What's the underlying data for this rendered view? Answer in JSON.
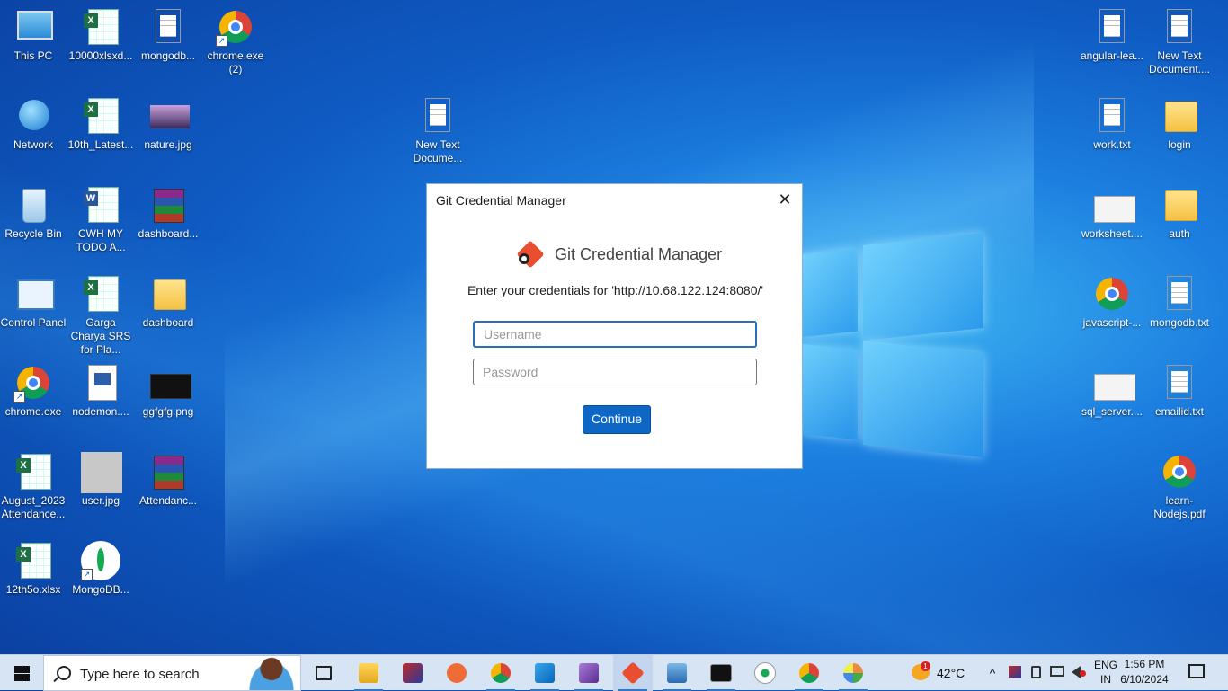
{
  "desktop": {
    "icons_left": [
      {
        "label": "This PC",
        "icon": "this-pc-icon"
      },
      {
        "label": "10000xlsxd...",
        "icon": "excel-file-icon"
      },
      {
        "label": "mongodb...",
        "icon": "text-file-icon"
      },
      {
        "label": "chrome.exe (2)",
        "icon": "chrome-icon"
      },
      {
        "label": "Network",
        "icon": "network-icon"
      },
      {
        "label": "10th_Latest...",
        "icon": "excel-file-icon"
      },
      {
        "label": "nature.jpg",
        "icon": "image-file-icon"
      },
      {
        "label": "Recycle Bin",
        "icon": "recycle-bin-icon"
      },
      {
        "label": "CWH MY TODO A...",
        "icon": "word-file-icon"
      },
      {
        "label": "dashboard...",
        "icon": "rar-archive-icon"
      },
      {
        "label": "Control Panel",
        "icon": "control-panel-icon"
      },
      {
        "label": "Garga Charya SRS for Pla...",
        "icon": "excel-file-icon"
      },
      {
        "label": "dashboard",
        "icon": "folder-icon"
      },
      {
        "label": "chrome.exe",
        "icon": "chrome-icon"
      },
      {
        "label": "nodemon....",
        "icon": "powershell-file-icon"
      },
      {
        "label": "ggfgfg.png",
        "icon": "image-file-icon"
      },
      {
        "label": "August_2023 Attendance...",
        "icon": "excel-file-icon"
      },
      {
        "label": "user.jpg",
        "icon": "user-image-icon"
      },
      {
        "label": "Attendanc...",
        "icon": "rar-archive-icon"
      },
      {
        "label": "12th5o.xlsx",
        "icon": "excel-file-icon"
      },
      {
        "label": "MongoDB...",
        "icon": "mongodb-icon"
      }
    ],
    "icon_middle": {
      "label": "New Text Docume...",
      "icon": "text-file-icon"
    },
    "icons_right": [
      {
        "label": "angular-lea...",
        "icon": "text-file-icon"
      },
      {
        "label": "New Text Document....",
        "icon": "text-file-icon"
      },
      {
        "label": "work.txt",
        "icon": "text-file-icon"
      },
      {
        "label": "login",
        "icon": "folder-icon"
      },
      {
        "label": "worksheet....",
        "icon": "screenshot-file-icon"
      },
      {
        "label": "auth",
        "icon": "folder-icon"
      },
      {
        "label": "javascript-...",
        "icon": "chrome-html-file-icon"
      },
      {
        "label": "mongodb.txt",
        "icon": "text-file-icon"
      },
      {
        "label": "sql_server....",
        "icon": "screenshot-file-icon"
      },
      {
        "label": "emailid.txt",
        "icon": "text-file-icon"
      },
      {
        "label": "learn-Nodejs.pdf",
        "icon": "chrome-pdf-icon"
      }
    ]
  },
  "dialog": {
    "window_title": "Git Credential Manager",
    "close_glyph": "✕",
    "brand_title": "Git Credential Manager",
    "prompt": "Enter your credentials for 'http://10.68.122.124:8080/'",
    "username_placeholder": "Username",
    "password_placeholder": "Password",
    "continue_label": "Continue"
  },
  "taskbar": {
    "search_placeholder": "Type here to search",
    "apps": [
      "task-view-icon",
      "file-explorer-icon",
      "image-app-icon",
      "postman-icon",
      "chrome-icon",
      "vscode-icon",
      "visual-studio-icon",
      "git-credential-manager-icon",
      "remote-desktop-icon",
      "terminal-icon",
      "mongodb-compass-icon",
      "chrome-icon",
      "paint-icon"
    ],
    "weather": {
      "temp": "42°C",
      "badge": "1"
    },
    "language": {
      "line1": "ENG",
      "line2": "IN"
    },
    "clock": {
      "time": "1:56 PM",
      "date": "6/10/2024"
    }
  },
  "colors": {
    "accent": "#0e67c4",
    "git_brand": "#e94e31",
    "taskbar": "#d7e4f4"
  }
}
